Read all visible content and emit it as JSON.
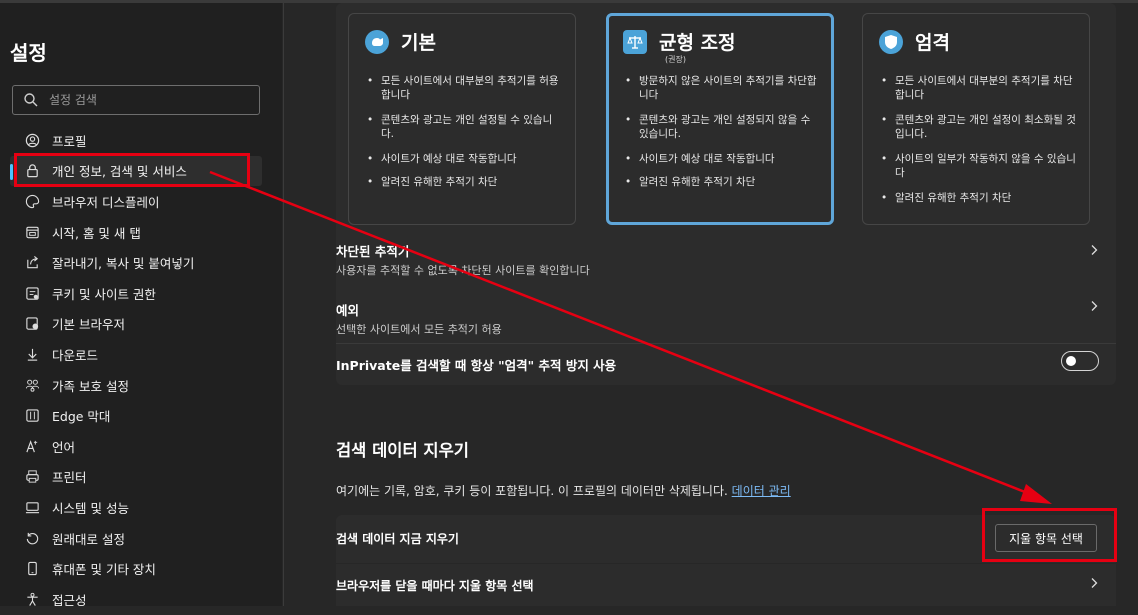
{
  "sidebar": {
    "title": "설정",
    "search_placeholder": "설정 검색",
    "items": [
      {
        "label": "프로필",
        "icon": "profile-icon"
      },
      {
        "label": "개인 정보, 검색 및 서비스",
        "icon": "lock-icon",
        "active": true
      },
      {
        "label": "브라우저 디스플레이",
        "icon": "appearance-icon"
      },
      {
        "label": "시작, 홈 및 새 탭",
        "icon": "start-page-icon"
      },
      {
        "label": "잘라내기, 복사 및 붙여넣기",
        "icon": "share-icon"
      },
      {
        "label": "쿠키 및 사이트 권한",
        "icon": "cookie-icon"
      },
      {
        "label": "기본 브라우저",
        "icon": "default-browser-icon"
      },
      {
        "label": "다운로드",
        "icon": "download-icon"
      },
      {
        "label": "가족 보호 설정",
        "icon": "family-icon"
      },
      {
        "label": "Edge 막대",
        "icon": "edge-bar-icon"
      },
      {
        "label": "언어",
        "icon": "language-icon"
      },
      {
        "label": "프린터",
        "icon": "printer-icon"
      },
      {
        "label": "시스템 및 성능",
        "icon": "system-icon"
      },
      {
        "label": "원래대로 설정",
        "icon": "reset-icon"
      },
      {
        "label": "휴대폰 및 기타 장치",
        "icon": "phone-icon"
      },
      {
        "label": "접근성",
        "icon": "accessibility-icon"
      }
    ]
  },
  "tracking": {
    "cards": [
      {
        "title": "기본",
        "subtitle": "",
        "icon": "basic-tracking-icon",
        "selected": false,
        "bullets": [
          "모든 사이트에서 대부분의 추적기를 허용합니다",
          "콘텐츠와 광고는 개인 설정될 수 있습니다.",
          "사이트가 예상 대로 작동합니다",
          "알려진 유해한 추적기 차단"
        ]
      },
      {
        "title": "균형 조정",
        "subtitle": "(권장)",
        "icon": "balanced-scale-icon",
        "selected": true,
        "bullets": [
          "방문하지 않은 사이트의 추적기를 차단합니다",
          "콘텐츠와 광고는 개인 설정되지 않을 수 있습니다.",
          "사이트가 예상 대로 작동합니다",
          "알려진 유해한 추적기 차단"
        ]
      },
      {
        "title": "엄격",
        "subtitle": "",
        "icon": "strict-shield-icon",
        "selected": false,
        "bullets": [
          "모든 사이트에서 대부분의 추적기를 차단합니다",
          "콘텐츠와 광고는 개인 설정이 최소화될 것입니다.",
          "사이트의 일부가 작동하지 않을 수 있습니다",
          "알려진 유해한 추적기 차단"
        ]
      }
    ],
    "blocked_title": "차단된 추적기",
    "blocked_desc": "사용자를 추적할 수 없도록 차단된 사이트를 확인합니다",
    "exceptions_title": "예외",
    "exceptions_desc": "선택한 사이트에서 모든 추적기 허용",
    "inprivate_label": "InPrivate를 검색할 때 항상 \"엄격\" 추적 방지 사용",
    "inprivate_on": false
  },
  "clear": {
    "title": "검색 데이터 지우기",
    "desc": "여기에는 기록, 암호, 쿠키 등이 포함됩니다. 이 프로필의 데이터만 삭제됩니다.",
    "manage_link": "데이터 관리",
    "clear_now_label": "검색 데이터 지금 지우기",
    "choose_button": "지울 항목 선택",
    "on_close_label": "브라우저를 닫을 때마다 지울 항목 선택"
  },
  "colors": {
    "accent": "#4cc2ff",
    "selected_border": "#5fa6d9",
    "annotation_red": "#e60012"
  }
}
